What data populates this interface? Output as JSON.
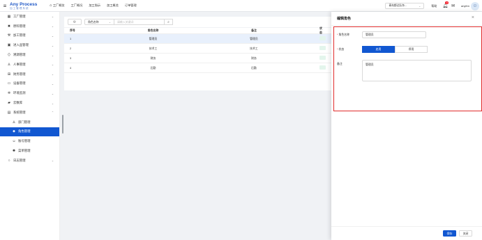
{
  "header": {
    "logo_title": "Any Process",
    "logo_subtitle": "加工管理系统",
    "nav": [
      {
        "icon": "home-icon",
        "glyph": "⌂",
        "label": "工厂概览"
      },
      {
        "label": "工厂概况"
      },
      {
        "label": "加工指示"
      },
      {
        "label": "加工概览"
      },
      {
        "label": "订单管理"
      }
    ],
    "factory_select": "青岛都达队杂...",
    "help": "帮助",
    "notification_count": "0",
    "username": "anyfen"
  },
  "sidebar": {
    "items": [
      {
        "icon": "factory-icon",
        "glyph": "▦",
        "label": "工厂管理",
        "chev": "⌄"
      },
      {
        "icon": "material-icon",
        "glyph": "✖",
        "label": "原料管理",
        "chev": "⌄"
      },
      {
        "icon": "tool-icon",
        "glyph": "⚒",
        "label": "加工管理",
        "chev": "⌄"
      },
      {
        "icon": "inbound-icon",
        "glyph": "▣",
        "label": "进入品管理",
        "chev": "⌄"
      },
      {
        "icon": "traceability-icon",
        "glyph": "⟨⟩",
        "label": "溯源管理",
        "chev": "⌄"
      },
      {
        "icon": "user-icon",
        "glyph": "♙",
        "label": "人事管理",
        "chev": "⌄"
      },
      {
        "icon": "finance-icon",
        "glyph": "⊞",
        "label": "财务管理",
        "chev": "⌄"
      },
      {
        "icon": "device-icon",
        "glyph": "▭",
        "label": "设备管理",
        "chev": "⌄"
      },
      {
        "icon": "environment-icon",
        "glyph": "✲",
        "label": "环境监测",
        "chev": "⌄"
      },
      {
        "icon": "cloud-icon",
        "glyph": "▰",
        "label": "云数库",
        "chev": "⌄"
      },
      {
        "icon": "system-icon",
        "glyph": "▤",
        "label": "系统管理",
        "chev": "⌃"
      }
    ],
    "sub_items": [
      {
        "icon": "department-icon",
        "glyph": "♙",
        "label": "部门管理"
      },
      {
        "icon": "role-icon",
        "glyph": "☻",
        "label": "角色管理",
        "active": true
      },
      {
        "icon": "account-icon",
        "glyph": "☺",
        "label": "账号管理"
      },
      {
        "icon": "menu-icon",
        "glyph": "✺",
        "label": "菜单管理"
      }
    ],
    "log_item": {
      "icon": "log-icon",
      "glyph": "○",
      "label": "日志管理",
      "chev": "⌄"
    }
  },
  "toolbar": {
    "field_select": "角色名称",
    "search_placeholder": "请输入关键词"
  },
  "table": {
    "headers": {
      "no": "序号",
      "name": "角色名称",
      "note": "备注",
      "status": "状态"
    },
    "rows": [
      {
        "no": "1",
        "name": "管理员",
        "note": "管理员"
      },
      {
        "no": "2",
        "name": "技术工",
        "note": "技术工"
      },
      {
        "no": "3",
        "name": "财务",
        "note": "财务"
      },
      {
        "no": "4",
        "name": "后勤",
        "note": "后勤"
      }
    ]
  },
  "drawer": {
    "title": "编辑角色",
    "close_glyph": "×",
    "fields": {
      "role_name_label": "角色名称",
      "role_name_value": "管理员",
      "status_label": "状态",
      "status_on": "启用",
      "status_off": "停用",
      "note_label": "备注",
      "note_value": "管理员"
    },
    "save_label": "保存",
    "close_label": "关闭"
  }
}
